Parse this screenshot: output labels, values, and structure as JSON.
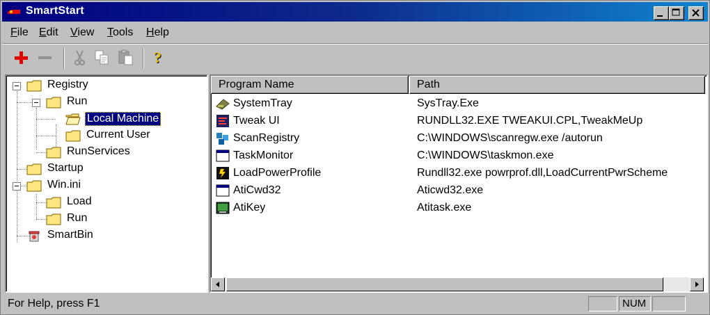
{
  "window": {
    "title": "SmartStart"
  },
  "menu": [
    {
      "label": "File",
      "key": "F",
      "rest": "ile"
    },
    {
      "label": "Edit",
      "key": "E",
      "rest": "dit"
    },
    {
      "label": "View",
      "key": "V",
      "rest": "iew"
    },
    {
      "label": "Tools",
      "key": "T",
      "rest": "ools"
    },
    {
      "label": "Help",
      "key": "H",
      "rest": "elp"
    }
  ],
  "toolbar": {
    "buttons": [
      "add-icon",
      "remove-icon",
      "cut-icon",
      "copy-icon",
      "paste-icon",
      "help-icon"
    ]
  },
  "tree": {
    "registry": "Registry",
    "run": "Run",
    "local_machine": "Local Machine",
    "current_user": "Current User",
    "run_services": "RunServices",
    "startup": "Startup",
    "win_ini": "Win.ini",
    "load": "Load",
    "win_run": "Run",
    "smartbin": "SmartBin"
  },
  "list": {
    "columns": [
      "Program Name",
      "Path"
    ],
    "rows": [
      {
        "name": "SystemTray",
        "path": "SysTray.Exe",
        "icon": "systray-icon"
      },
      {
        "name": "Tweak UI",
        "path": "RUNDLL32.EXE TWEAKUI.CPL,TweakMeUp",
        "icon": "tweakui-icon"
      },
      {
        "name": "ScanRegistry",
        "path": "C:\\WINDOWS\\scanregw.exe /autorun",
        "icon": "scanregistry-icon"
      },
      {
        "name": "TaskMonitor",
        "path": "C:\\WINDOWS\\taskmon.exe",
        "icon": "taskmonitor-icon"
      },
      {
        "name": "LoadPowerProfile",
        "path": "Rundll32.exe powrprof.dll,LoadCurrentPwrScheme",
        "icon": "power-icon"
      },
      {
        "name": "AtiCwd32",
        "path": "Aticwd32.exe",
        "icon": "window-app-icon"
      },
      {
        "name": "AtiKey",
        "path": "Atitask.exe",
        "icon": "atikey-icon"
      }
    ]
  },
  "status": {
    "help_text": "For Help, press F1",
    "num": "NUM"
  },
  "colors": {
    "titlebar": "#000080",
    "face": "#c0c0c0",
    "selection": "#000080"
  }
}
